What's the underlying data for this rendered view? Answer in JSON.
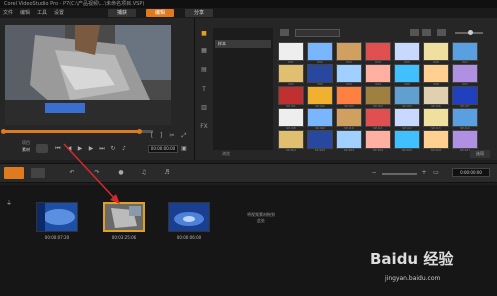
{
  "window": {
    "title": "Corel VideoStudio Pro - P7(C:\\产品视频\\...\\未命名项目.VSP)"
  },
  "menu": {
    "items": [
      "文件",
      "编辑",
      "工具",
      "设置"
    ]
  },
  "steps": {
    "capture": "捕获",
    "edit": "编辑",
    "share": "分享"
  },
  "preview": {
    "mode_project": "项目",
    "mode_clip": "素材",
    "timecode": "00:00:00:00"
  },
  "library": {
    "add_label": "添加",
    "folder_name": "样本",
    "browse_label": "浏览",
    "options_label": "选项",
    "thumb_labels": [
      "P01",
      "P02",
      "P03",
      "P04",
      "P05",
      "P06",
      "P07",
      "V01",
      "V02",
      "V03",
      "V04",
      "V05",
      "V06",
      "V07",
      "SP-I01",
      "SP-I02",
      "SP-I03",
      "SP-I04",
      "SP-I05",
      "SP-I06",
      "SP-I07",
      "SP-I08",
      "SP-I09",
      "SP-I10",
      "SP-I11",
      "SP-I12",
      "SP-I13",
      "SP-I14",
      "SP-S01",
      "SP-S02",
      "SP-S03",
      "SP-S04",
      "SP-S05",
      "SP-S06",
      "SP-S07"
    ]
  },
  "timeline": {
    "total_time": "0:00:00:00"
  },
  "storyboard": {
    "clips": [
      {
        "time": "00:00:07:20"
      },
      {
        "time": "00:03:25:06"
      },
      {
        "time": "00:00:06:00"
      }
    ],
    "drop_hint": "将视频素材拖到此处"
  },
  "watermark": {
    "brand": "Baidu 经验",
    "url": "jingyan.baidu.com"
  },
  "colors": {
    "accent": "#e07a1f",
    "selected_clip_border": "#e0a020",
    "arrow": "#d42a2a"
  }
}
